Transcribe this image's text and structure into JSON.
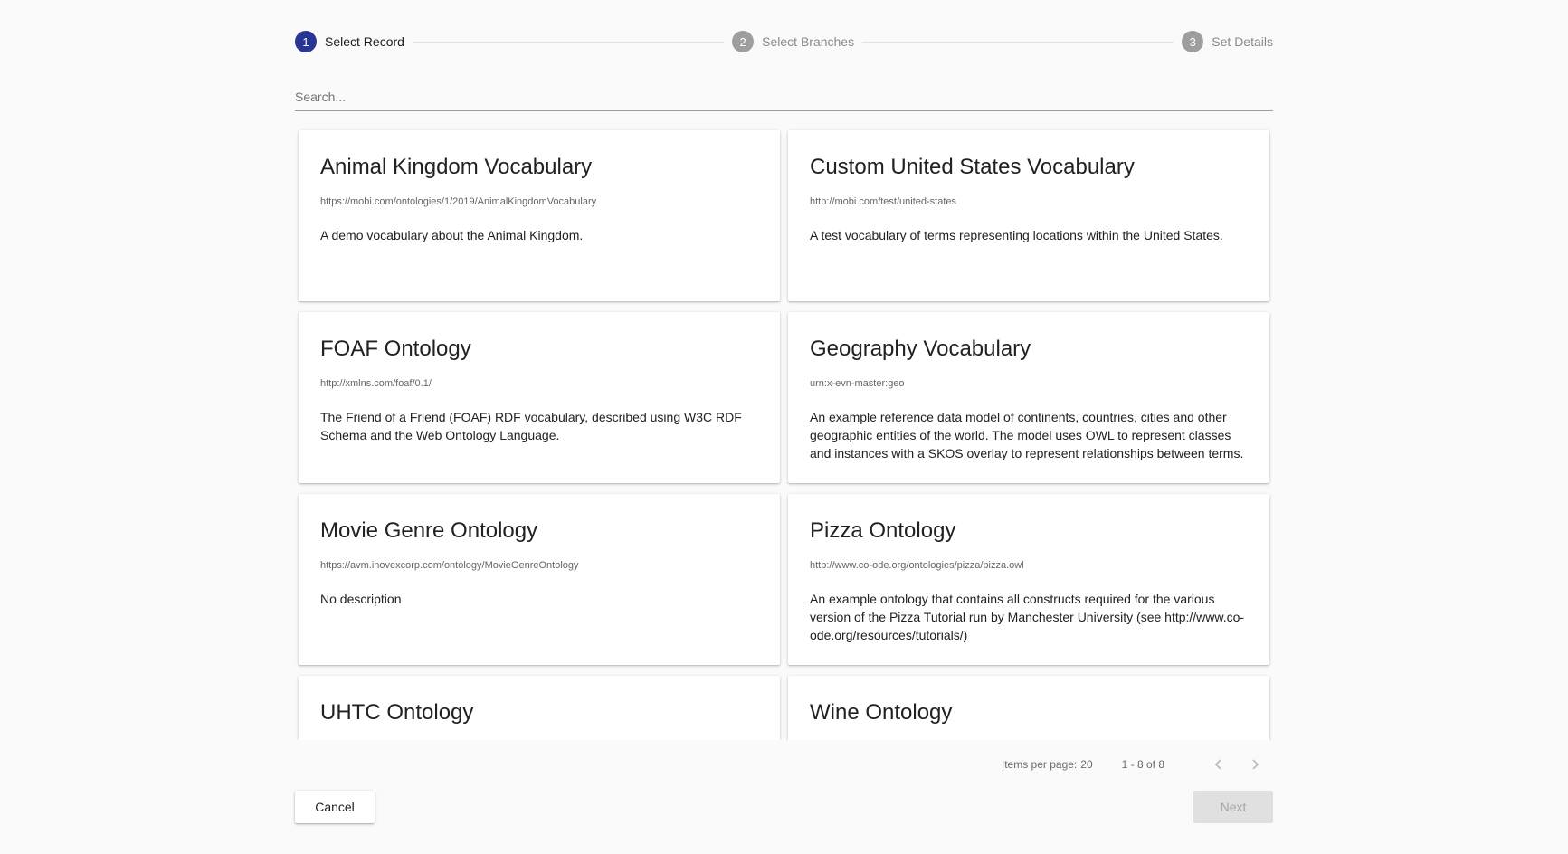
{
  "stepper": {
    "steps": [
      {
        "number": "1",
        "label": "Select Record",
        "state": "active"
      },
      {
        "number": "2",
        "label": "Select Branches",
        "state": "inactive"
      },
      {
        "number": "3",
        "label": "Set Details",
        "state": "inactive"
      }
    ]
  },
  "search": {
    "placeholder": "Search...",
    "value": ""
  },
  "records": [
    {
      "title": "Animal Kingdom Vocabulary",
      "iri": "https://mobi.com/ontologies/1/2019/AnimalKingdomVocabulary",
      "description": "A demo vocabulary about the Animal Kingdom."
    },
    {
      "title": "Custom United States Vocabulary",
      "iri": "http://mobi.com/test/united-states",
      "description": "A test vocabulary of terms representing locations within the United States."
    },
    {
      "title": "FOAF Ontology",
      "iri": "http://xmlns.com/foaf/0.1/",
      "description": "The Friend of a Friend (FOAF) RDF vocabulary, described using W3C RDF Schema and the Web Ontology Language."
    },
    {
      "title": "Geography Vocabulary",
      "iri": "urn:x-evn-master:geo",
      "description": "An example reference data model of continents, countries, cities and other geographic entities of the world. The model uses OWL to represent classes and instances with a SKOS overlay to represent relationships between terms."
    },
    {
      "title": "Movie Genre Ontology",
      "iri": "https://avm.inovexcorp.com/ontology/MovieGenreOntology",
      "description": "No description"
    },
    {
      "title": "Pizza Ontology",
      "iri": "http://www.co-ode.org/ontologies/pizza/pizza.owl",
      "description": "An example ontology that contains all constructs required for the various version of the Pizza Tutorial run by Manchester University (see http://www.co-ode.org/resources/tutorials/)"
    },
    {
      "title": "UHTC Ontology",
      "iri": "",
      "description": ""
    },
    {
      "title": "Wine Ontology",
      "iri": "",
      "description": ""
    }
  ],
  "paginator": {
    "items_per_page_label": "Items per page:",
    "items_per_page": "20",
    "range": "1 - 8 of 8",
    "prev_icon": "chevron-left-icon",
    "next_icon": "chevron-right-icon"
  },
  "actions": {
    "cancel_label": "Cancel",
    "next_label": "Next"
  },
  "colors": {
    "accent": "#283593",
    "inactive_step": "#9e9e9e",
    "disabled_button": "#e0e0e0"
  }
}
